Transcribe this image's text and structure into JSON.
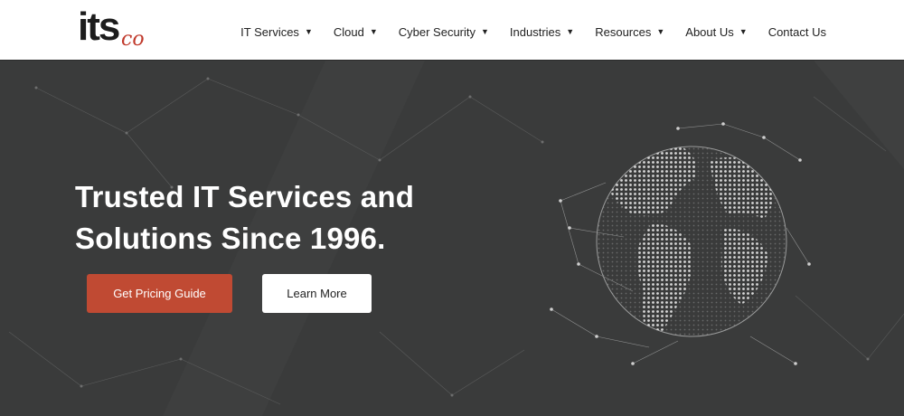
{
  "logo": {
    "main": "its",
    "sub": "co"
  },
  "nav": {
    "items": [
      {
        "label": "IT Services",
        "has_caret": true
      },
      {
        "label": "Cloud",
        "has_caret": true
      },
      {
        "label": "Cyber Security",
        "has_caret": true
      },
      {
        "label": "Industries",
        "has_caret": true
      },
      {
        "label": "Resources",
        "has_caret": true
      },
      {
        "label": "About Us",
        "has_caret": true
      },
      {
        "label": "Contact Us",
        "has_caret": false
      }
    ]
  },
  "hero": {
    "headline_line1": "Trusted IT Services and",
    "headline_line2": "Solutions Since 1996.",
    "primary_button": "Get Pricing Guide",
    "secondary_button": "Learn More"
  },
  "colors": {
    "accent": "#c04a33",
    "logo_accent": "#c0392b",
    "hero_background": "#3a3b3b",
    "header_background": "#ffffff"
  },
  "icons": {
    "nav_caret": "caret-down-icon",
    "hero_graphic": "globe-network-icon"
  }
}
